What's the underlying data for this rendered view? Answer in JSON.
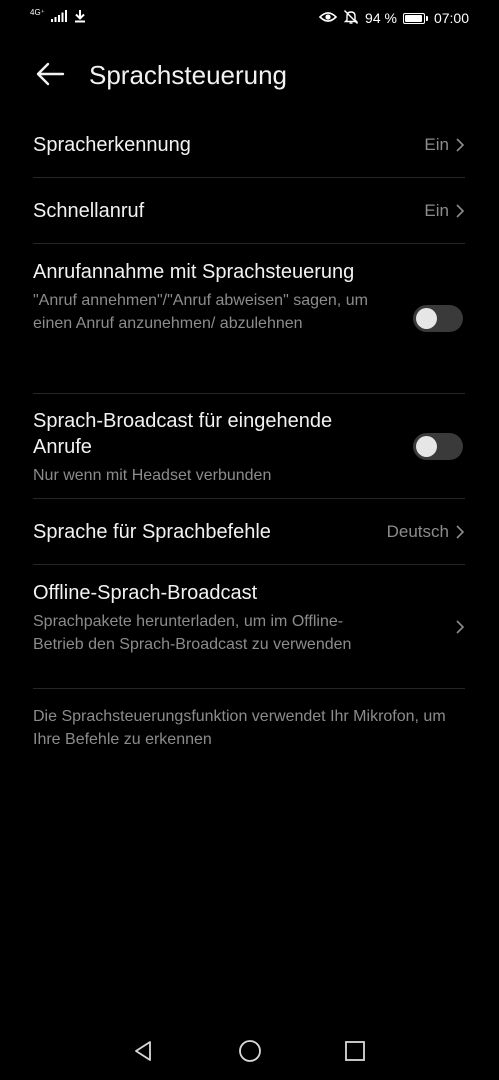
{
  "status_bar": {
    "network_type": "4G⁺",
    "battery_percent_text": "94 %",
    "battery_level": 0.94,
    "time": "07:00",
    "icons": [
      "signal-icon",
      "download-icon",
      "eye-icon",
      "mute-icon",
      "battery-icon"
    ]
  },
  "header": {
    "title": "Sprachsteuerung",
    "back_icon": "back-arrow-icon"
  },
  "settings": {
    "spracherkennung": {
      "title": "Spracherkennung",
      "value": "Ein"
    },
    "schnellanruf": {
      "title": "Schnellanruf",
      "value": "Ein"
    },
    "anrufannahme": {
      "title": "Anrufannahme mit Sprachsteuerung",
      "subtitle": "\"Anruf annehmen\"/\"Anruf abweisen\" sagen, um einen Anruf anzunehmen/ abzulehnen",
      "enabled": false
    },
    "broadcast": {
      "title": "Sprach-Broadcast für eingehende Anrufe",
      "subtitle": "Nur wenn mit Headset verbunden",
      "enabled": false
    },
    "sprache": {
      "title": "Sprache für Sprachbefehle",
      "value": "Deutsch"
    },
    "offline": {
      "title": "Offline-Sprach-Broadcast",
      "subtitle": "Sprachpakete herunterladen, um im Offline-Betrieb den Sprach-Broadcast zu verwenden"
    }
  },
  "footer_note": "Die Sprachsteuerungsfunktion verwendet Ihr Mikrofon, um Ihre Befehle zu erkennen",
  "nav_bar": {
    "icons": [
      "nav-back-icon",
      "nav-home-icon",
      "nav-recents-icon"
    ]
  },
  "colors": {
    "background": "#000000",
    "primary_text": "#f2f2f2",
    "secondary_text": "#8c8c8c",
    "divider": "#262626",
    "toggle_off": "#3a3a3a"
  }
}
